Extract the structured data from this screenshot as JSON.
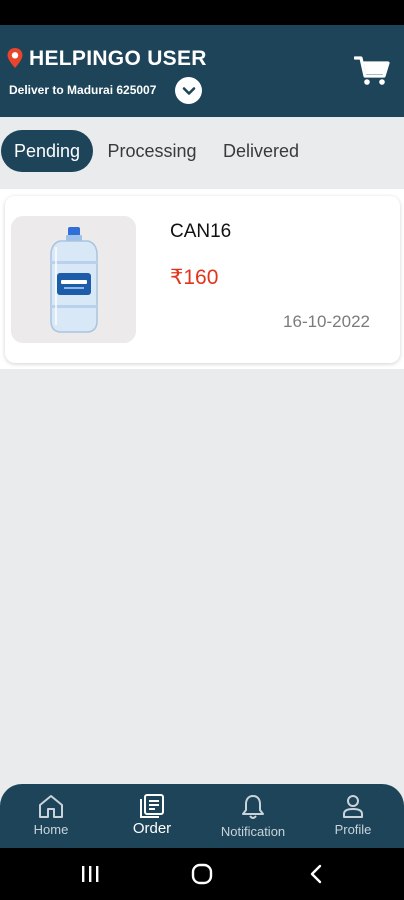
{
  "header": {
    "title": "HELPINGO USER",
    "deliver_text": "Deliver to Madurai 625007"
  },
  "tabs": [
    {
      "label": "Pending",
      "active": true
    },
    {
      "label": "Processing",
      "active": false
    },
    {
      "label": "Delivered",
      "active": false
    }
  ],
  "orders": [
    {
      "name": "CAN16",
      "price": "₹160",
      "date": "16-10-2022",
      "image_icon": "water-can-icon"
    }
  ],
  "bottom_nav": [
    {
      "label": "Home",
      "icon": "home-icon",
      "active": false
    },
    {
      "label": "Order",
      "icon": "order-icon",
      "active": true
    },
    {
      "label": "Notification",
      "icon": "bell-icon",
      "active": false
    },
    {
      "label": "Profile",
      "icon": "profile-icon",
      "active": false
    }
  ],
  "colors": {
    "brand": "#1d4459",
    "price": "#e2341b",
    "background": "#e9ebec",
    "pin": "#e8452c"
  }
}
